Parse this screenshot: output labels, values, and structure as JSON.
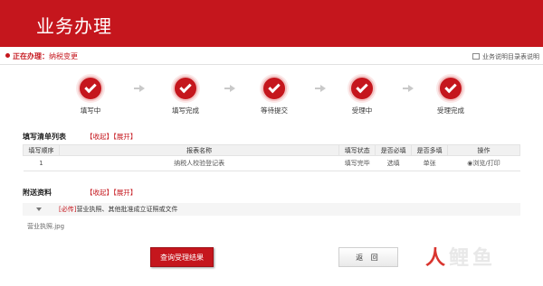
{
  "header": {
    "title": "业务办理"
  },
  "subbar": {
    "current_label": "正在办理：",
    "current_value": "纳税变更",
    "help_text": "业务说明目录表说明"
  },
  "steps": [
    {
      "label": "填写中"
    },
    {
      "label": "填写完成"
    },
    {
      "label": "等待提交"
    },
    {
      "label": "受理中"
    },
    {
      "label": "受理完成"
    }
  ],
  "list": {
    "title": "填写清单列表",
    "collapse": "【收起】",
    "expand": "【展开】",
    "headers": [
      "填写顺序",
      "报表名称",
      "填写状态",
      "是否必填",
      "是否多填",
      "操作"
    ],
    "rows": [
      {
        "order": "1",
        "name": "纳税人校验登记表",
        "status": "填写完毕",
        "required": "选填",
        "multi": "单张",
        "op": "◉浏览/打印"
      }
    ]
  },
  "attach": {
    "title": "附送资料",
    "collapse": "【收起】",
    "expand": "【展开】",
    "tag": "[必传]",
    "text": "营业执照、其他批准成立证照或文件",
    "file": "营业执照.jpg"
  },
  "buttons": {
    "query": "查询受理结果",
    "back": "返 回"
  },
  "watermark": {
    "text1": "人",
    "text2": "鲤鱼"
  }
}
